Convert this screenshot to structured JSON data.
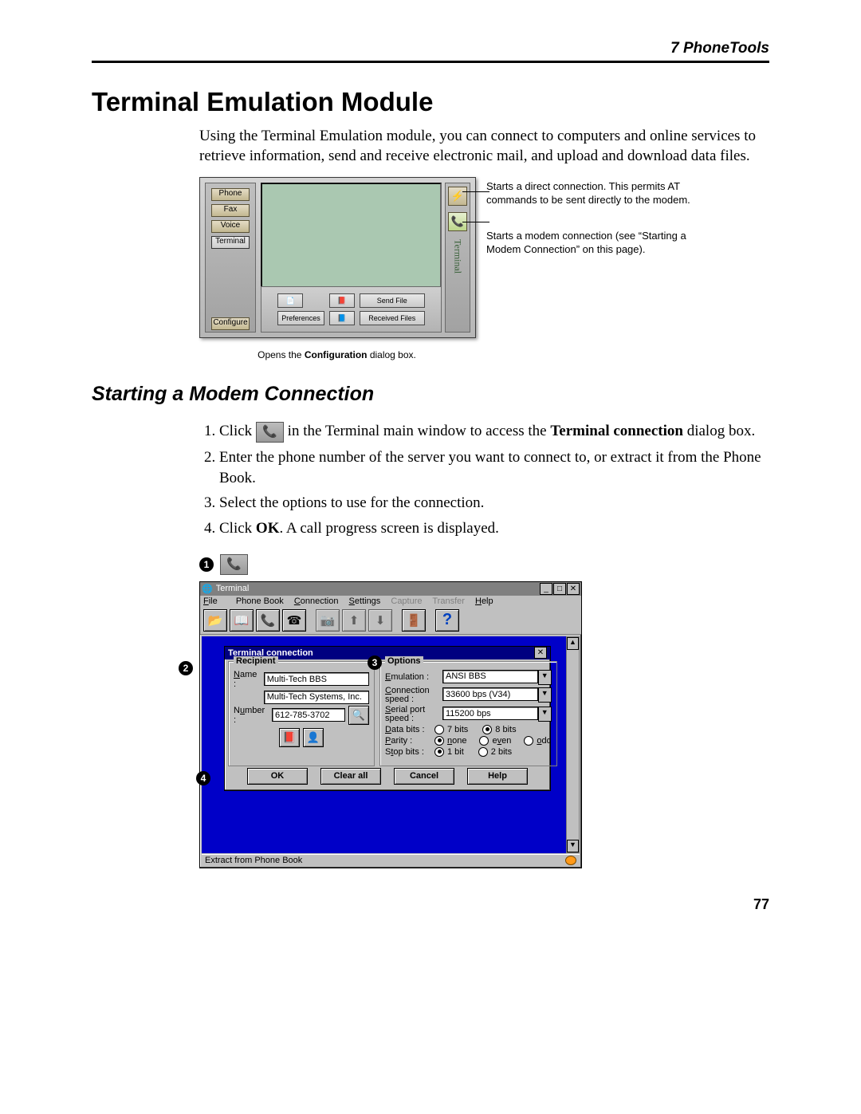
{
  "running_head": "7  PhoneTools",
  "title": "Terminal Emulation Module",
  "intro": "Using the Terminal Emulation module, you can connect to computers and online services to retrieve information, send and receive electronic mail, and upload and download data files.",
  "shot1": {
    "side_buttons": {
      "phone": "Phone",
      "fax": "Fax",
      "voice": "Voice",
      "terminal": "Terminal",
      "configure": "Configure"
    },
    "bottom": {
      "preferences": "Preferences",
      "send_file": "Send File",
      "received_files": "Received Files"
    },
    "right_label": "Terminal",
    "callout_a": "Starts a direct connection. This permits AT commands to be sent directly to the modem.",
    "callout_b": "Starts a modem connection (see “Starting a Modem Connection” on this page).",
    "caption_pre": "Opens the ",
    "caption_bold": "Configuration",
    "caption_post": " dialog box."
  },
  "subtitle": "Starting a Modem Connection",
  "steps": {
    "s1a": "Click ",
    "s1b": " in the Terminal main window to access the ",
    "s1bold": "Terminal connection",
    "s1c": " dialog box.",
    "s2": "Enter the phone number of the server you want to connect to, or extract it from the Phone Book.",
    "s3": "Select the options to use for the connection.",
    "s4a": "Click ",
    "s4bold": "OK",
    "s4b": ". A call progress screen is displayed."
  },
  "shot2": {
    "win_title": "Terminal",
    "menus": {
      "file": "File",
      "phonebook": "Phone Book",
      "connection": "Connection",
      "settings": "Settings",
      "capture": "Capture",
      "transfer": "Transfer",
      "help": "Help"
    },
    "dlg_title": "Terminal connection",
    "recipient": {
      "legend": "Recipient",
      "name_lbl": "Name :",
      "name_val": "Multi-Tech BBS",
      "company_val": "Multi-Tech Systems, Inc.",
      "number_lbl": "Number :",
      "number_val": "612-785-3702"
    },
    "options": {
      "legend": "Options",
      "emulation_lbl": "Emulation :",
      "emulation_val": "ANSI BBS",
      "connspeed_lbl": "Connection speed :",
      "connspeed_val": "33600 bps (V34)",
      "serialspeed_lbl": "Serial port speed :",
      "serialspeed_val": "115200 bps",
      "databits_lbl": "Data bits :",
      "databits_7": "7 bits",
      "databits_8": "8 bits",
      "parity_lbl": "Parity :",
      "parity_none": "none",
      "parity_even": "even",
      "parity_odd": "odd",
      "stopbits_lbl": "Stop bits :",
      "stopbits_1": "1 bit",
      "stopbits_2": "2 bits"
    },
    "buttons": {
      "ok": "OK",
      "clear": "Clear all",
      "cancel": "Cancel",
      "help": "Help"
    },
    "status": "Extract from Phone Book",
    "callouts": {
      "c1": "1",
      "c2": "2",
      "c3": "3",
      "c4": "4"
    }
  },
  "page_number": "77"
}
